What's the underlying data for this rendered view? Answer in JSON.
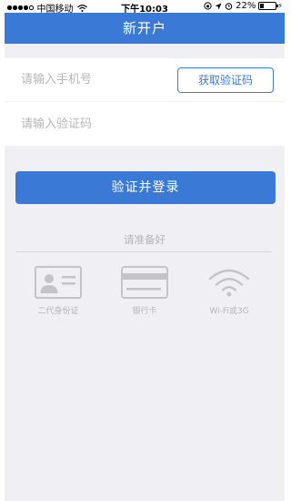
{
  "status_bar": {
    "carrier": "中国移动",
    "time": "下午10:03",
    "battery": "22%",
    "battery_level": 0.22
  },
  "nav": {
    "title": "新开户"
  },
  "form": {
    "phone_placeholder": "请输入手机号",
    "code_button": "获取验证码",
    "code_placeholder": "请输入验证码"
  },
  "submit_label": "验证并登录",
  "prepare": {
    "title": "请准备好",
    "items": [
      {
        "label": "二代身份证",
        "icon": "id-card-icon"
      },
      {
        "label": "银行卡",
        "icon": "bank-card-icon"
      },
      {
        "label": "Wi-Fi或3G",
        "icon": "wifi-icon"
      }
    ]
  },
  "colors": {
    "primary": "#3a79d6",
    "background": "#efeff4",
    "muted_icon": "#c4c4c8",
    "muted_text": "#b6b6b8"
  }
}
